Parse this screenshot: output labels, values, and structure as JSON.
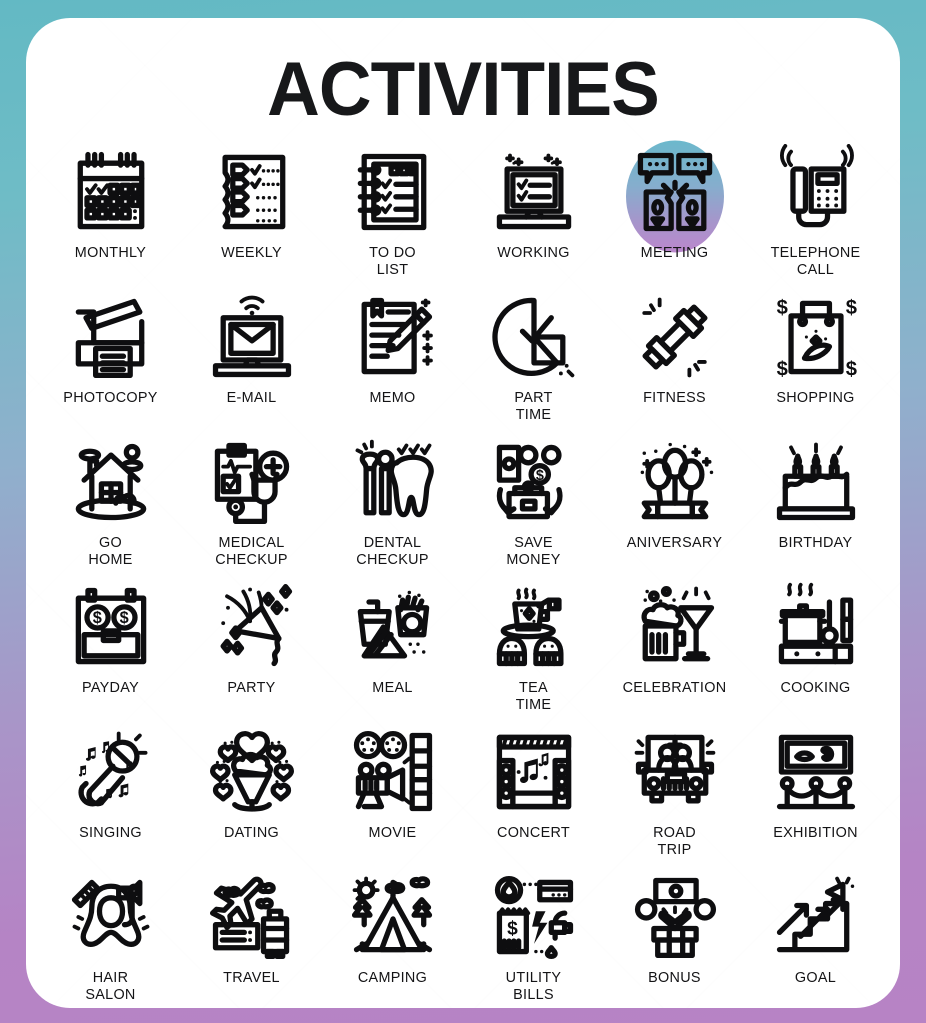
{
  "page": {
    "title": "ACTIVITIES",
    "background_gradient_from": "#63b9c4",
    "background_gradient_to": "#b783c5",
    "card_background": "#ffffff",
    "icon_stroke_color": "#0e0e10"
  },
  "grid": {
    "columns": 6,
    "rows": 6,
    "items": [
      {
        "label": "MONTHLY",
        "icon": "calendar-month-icon",
        "highlighted": false
      },
      {
        "label": "WEEKLY",
        "icon": "weekly-checklist-icon",
        "highlighted": false
      },
      {
        "label": "TO DO\nLIST",
        "icon": "todo-notebook-icon",
        "highlighted": false
      },
      {
        "label": "WORKING",
        "icon": "laptop-tasks-icon",
        "highlighted": false
      },
      {
        "label": "MEETING",
        "icon": "meeting-chat-icon",
        "highlighted": true
      },
      {
        "label": "TELEPHONE\nCALL",
        "icon": "telephone-icon",
        "highlighted": false
      },
      {
        "label": "PHOTOCOPY",
        "icon": "photocopier-icon",
        "highlighted": false
      },
      {
        "label": "E-MAIL",
        "icon": "email-laptop-icon",
        "highlighted": false
      },
      {
        "label": "MEMO",
        "icon": "memo-pencil-icon",
        "highlighted": false
      },
      {
        "label": "PART\nTIME",
        "icon": "pie-clock-icon",
        "highlighted": false
      },
      {
        "label": "FITNESS",
        "icon": "dumbbell-icon",
        "highlighted": false
      },
      {
        "label": "SHOPPING",
        "icon": "shopping-bag-icon",
        "highlighted": false
      },
      {
        "label": "GO\nHOME",
        "icon": "house-icon",
        "highlighted": false
      },
      {
        "label": "MEDICAL\nCHECKUP",
        "icon": "medical-clipboard-icon",
        "highlighted": false
      },
      {
        "label": "DENTAL\nCHECKUP",
        "icon": "tooth-icon",
        "highlighted": false
      },
      {
        "label": "SAVE\nMONEY",
        "icon": "save-money-icon",
        "highlighted": false
      },
      {
        "label": "ANIVERSARY",
        "icon": "balloons-banner-icon",
        "highlighted": false
      },
      {
        "label": "BIRTHDAY",
        "icon": "birthday-cake-icon",
        "highlighted": false
      },
      {
        "label": "PAYDAY",
        "icon": "payday-calendar-icon",
        "highlighted": false
      },
      {
        "label": "PARTY",
        "icon": "party-popper-icon",
        "highlighted": false
      },
      {
        "label": "MEAL",
        "icon": "fastfood-meal-icon",
        "highlighted": false
      },
      {
        "label": "TEA\nTIME",
        "icon": "teacup-cupcakes-icon",
        "highlighted": false
      },
      {
        "label": "CELEBRATION",
        "icon": "beer-cocktail-icon",
        "highlighted": false
      },
      {
        "label": "COOKING",
        "icon": "cooking-pot-icon",
        "highlighted": false
      },
      {
        "label": "SINGING",
        "icon": "microphone-icon",
        "highlighted": false
      },
      {
        "label": "DATING",
        "icon": "icecream-hearts-icon",
        "highlighted": false
      },
      {
        "label": "MOVIE",
        "icon": "movie-projector-icon",
        "highlighted": false
      },
      {
        "label": "CONCERT",
        "icon": "concert-stage-icon",
        "highlighted": false
      },
      {
        "label": "ROAD\nTRIP",
        "icon": "road-trip-car-icon",
        "highlighted": false
      },
      {
        "label": "EXHIBITION",
        "icon": "exhibition-painting-icon",
        "highlighted": false
      },
      {
        "label": "HAIR\nSALON",
        "icon": "hair-salon-icon",
        "highlighted": false
      },
      {
        "label": "TRAVEL",
        "icon": "airplane-ticket-icon",
        "highlighted": false
      },
      {
        "label": "CAMPING",
        "icon": "camping-tent-icon",
        "highlighted": false
      },
      {
        "label": "UTILITY\nBILLS",
        "icon": "utility-bills-icon",
        "highlighted": false
      },
      {
        "label": "BONUS",
        "icon": "gift-bonus-icon",
        "highlighted": false
      },
      {
        "label": "GOAL",
        "icon": "goal-stairs-icon",
        "highlighted": false
      }
    ]
  }
}
